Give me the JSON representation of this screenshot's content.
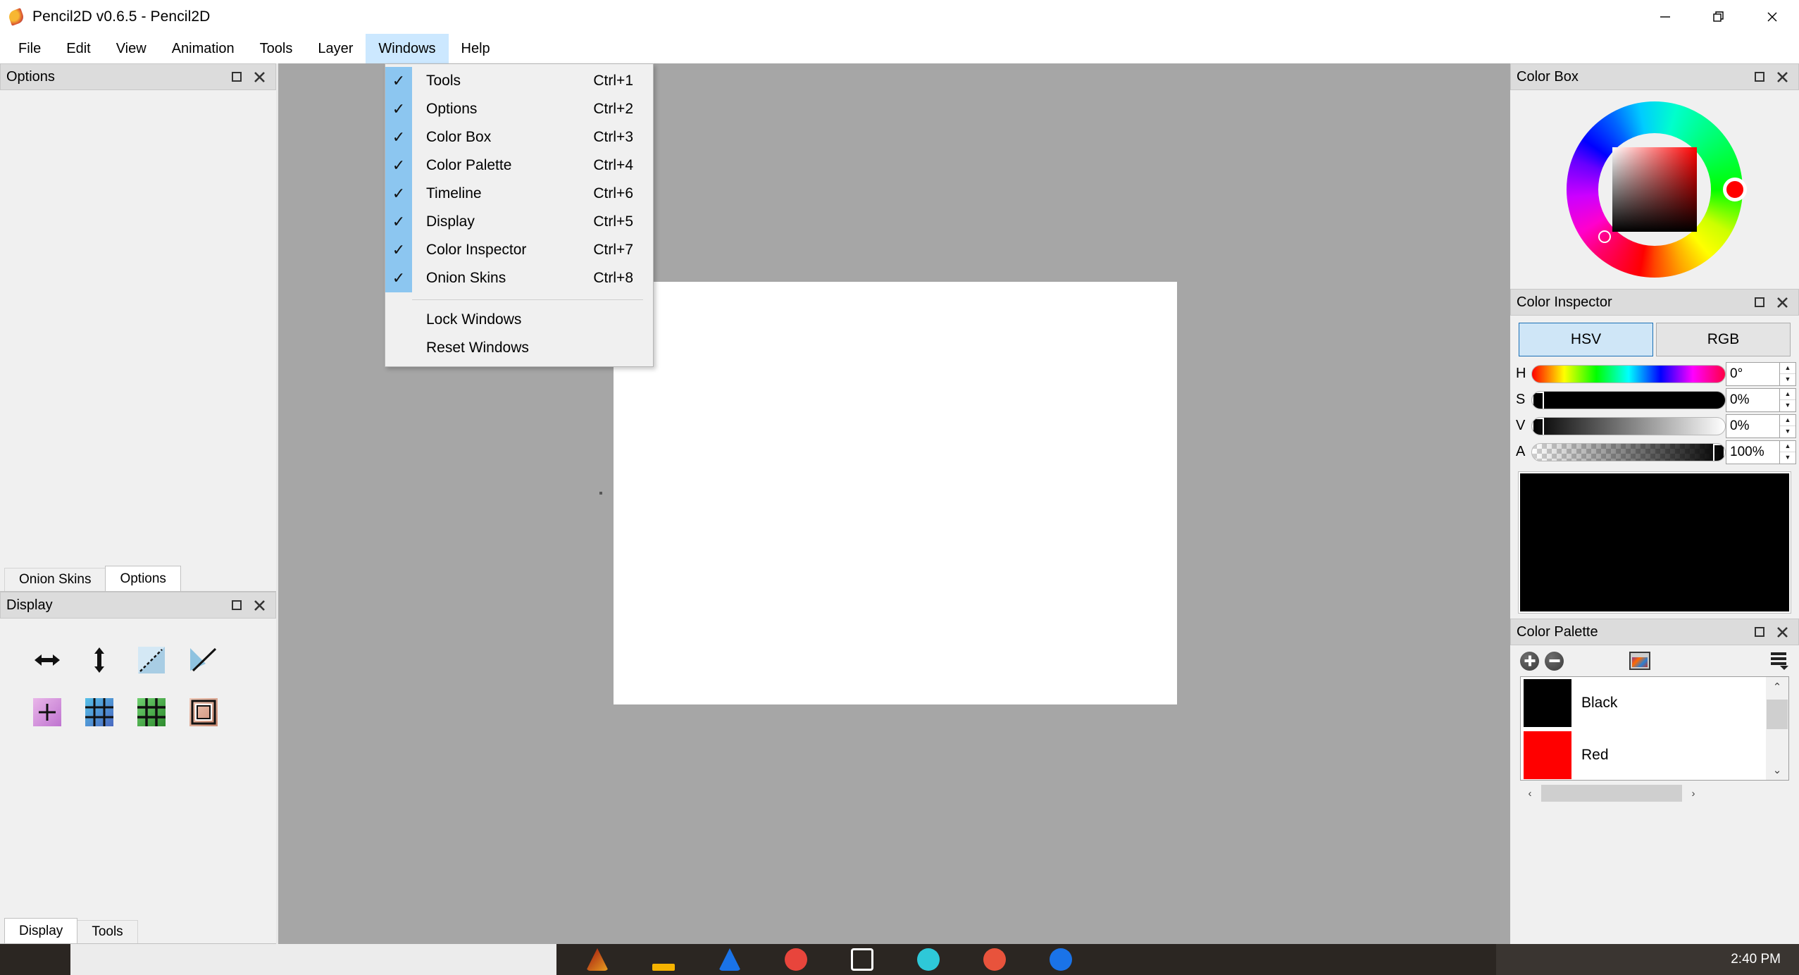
{
  "window": {
    "title": "Pencil2D v0.6.5 - Pencil2D",
    "app_icon": "pencil-icon",
    "minimize_label": "—",
    "maximize_label": "❐",
    "close_label": "✕"
  },
  "menubar": {
    "items": [
      {
        "label": "File",
        "open": false
      },
      {
        "label": "Edit",
        "open": false
      },
      {
        "label": "View",
        "open": false
      },
      {
        "label": "Animation",
        "open": false
      },
      {
        "label": "Tools",
        "open": false
      },
      {
        "label": "Layer",
        "open": false
      },
      {
        "label": "Windows",
        "open": true
      },
      {
        "label": "Help",
        "open": false
      }
    ]
  },
  "windows_menu": {
    "checkable_items": [
      {
        "label": "Tools",
        "shortcut": "Ctrl+1",
        "checked": true
      },
      {
        "label": "Options",
        "shortcut": "Ctrl+2",
        "checked": true
      },
      {
        "label": "Color Box",
        "shortcut": "Ctrl+3",
        "checked": true
      },
      {
        "label": "Color Palette",
        "shortcut": "Ctrl+4",
        "checked": true
      },
      {
        "label": "Timeline",
        "shortcut": "Ctrl+6",
        "checked": true
      },
      {
        "label": "Display",
        "shortcut": "Ctrl+5",
        "checked": true
      },
      {
        "label": "Color Inspector",
        "shortcut": "Ctrl+7",
        "checked": true
      },
      {
        "label": "Onion Skins",
        "shortcut": "Ctrl+8",
        "checked": true
      }
    ],
    "action_items": [
      {
        "label": "Lock Windows"
      },
      {
        "label": "Reset Windows"
      }
    ],
    "check_glyph": "✓"
  },
  "left_dock": {
    "options_panel": {
      "title": "Options",
      "float_icon": "restore-icon",
      "close_icon": "close-icon"
    },
    "options_tabs": [
      {
        "label": "Onion Skins",
        "active": false
      },
      {
        "label": "Options",
        "active": true
      }
    ],
    "display_panel": {
      "title": "Display",
      "float_icon": "restore-icon",
      "close_icon": "close-icon",
      "buttons": [
        {
          "name": "flip-horizontal-icon",
          "title": "Horizontal Flip"
        },
        {
          "name": "flip-vertical-icon",
          "title": "Vertical Flip"
        },
        {
          "name": "onion-prev-icon",
          "title": "Onion Skin Previous"
        },
        {
          "name": "onion-next-icon",
          "title": "Onion Skin Next"
        },
        {
          "name": "center-cross-icon",
          "title": "Center Guide"
        },
        {
          "name": "thirds-grid-icon",
          "title": "Thirds Grid"
        },
        {
          "name": "grid-icon",
          "title": "Grid"
        },
        {
          "name": "safe-area-icon",
          "title": "Safe Area"
        }
      ]
    },
    "display_tabs": [
      {
        "label": "Display",
        "active": true
      },
      {
        "label": "Tools",
        "active": false
      }
    ]
  },
  "canvas": {
    "background_color": "#a6a6a6",
    "paper_color": "#ffffff"
  },
  "right_dock": {
    "color_box": {
      "title": "Color Box",
      "float_icon": "restore-icon",
      "close_icon": "close-icon",
      "selected_color": "#ff0000",
      "wheel_name": "color-wheel"
    },
    "color_inspector": {
      "title": "Color Inspector",
      "float_icon": "restore-icon",
      "close_icon": "close-icon",
      "tabs": [
        {
          "label": "HSV",
          "active": true
        },
        {
          "label": "RGB",
          "active": false
        }
      ],
      "sliders": [
        {
          "label": "H",
          "value": "0°",
          "pos_pct": 0
        },
        {
          "label": "S",
          "value": "0%",
          "pos_pct": 0
        },
        {
          "label": "V",
          "value": "0%",
          "pos_pct": 0
        },
        {
          "label": "A",
          "value": "100%",
          "pos_pct": 100
        }
      ],
      "preview_color": "#000000",
      "spin_up_glyph": "▲",
      "spin_down_glyph": "▼"
    },
    "color_palette": {
      "title": "Color Palette",
      "float_icon": "restore-icon",
      "close_icon": "close-icon",
      "add_button": "add-color-button",
      "remove_button": "remove-color-button",
      "swatch_view_button": "swatch-view-button",
      "menu_button": "palette-menu-button",
      "colors": [
        {
          "name": "Black",
          "hex": "#000000"
        },
        {
          "name": "Red",
          "hex": "#ff0000"
        }
      ],
      "scroll_up_glyph": "⌃",
      "scroll_down_glyph": "⌄",
      "scroll_left_glyph": "‹",
      "scroll_right_glyph": "›"
    }
  },
  "taskbar": {
    "clock": "2:40 PM",
    "icons": [
      {
        "name": "firefox-icon",
        "color": "#e25822"
      },
      {
        "name": "app-yellow-icon",
        "color": "#f5b301"
      },
      {
        "name": "app-blue-icon",
        "color": "#1a73e8"
      },
      {
        "name": "app-red-icon",
        "color": "#e8453c"
      },
      {
        "name": "app-window-icon",
        "color": "#ffffff"
      },
      {
        "name": "app-cyan-icon",
        "color": "#2ec8d8"
      },
      {
        "name": "app-orange-icon",
        "color": "#e8533c"
      },
      {
        "name": "app-blue2-icon",
        "color": "#1a73e8"
      }
    ]
  }
}
